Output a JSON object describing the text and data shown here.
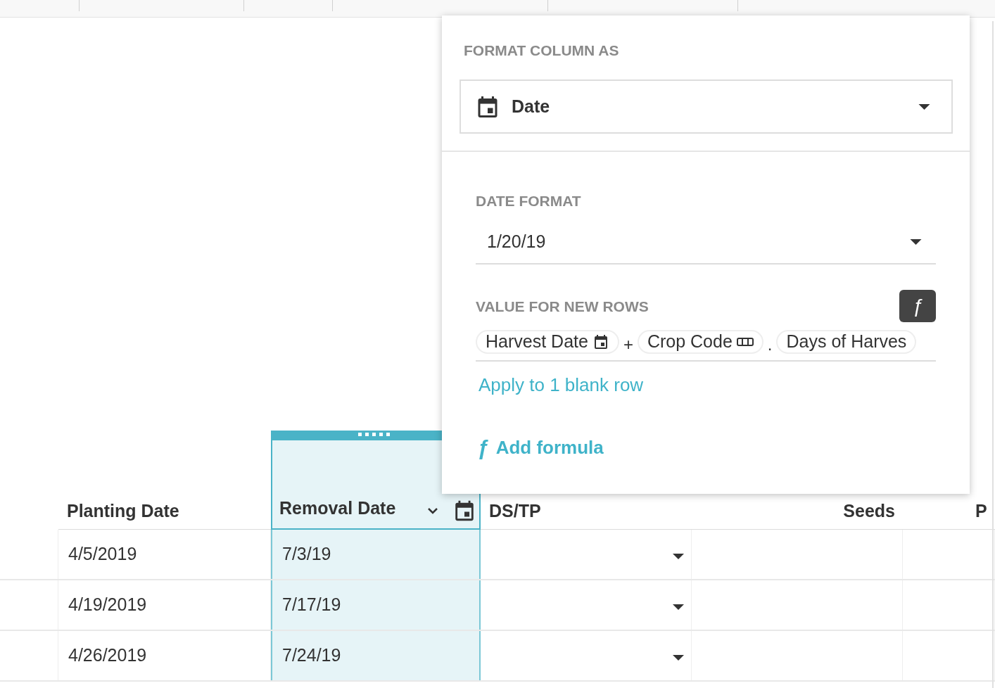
{
  "table": {
    "columns": [
      {
        "label": "Planting Date",
        "selected": false,
        "kind": "text"
      },
      {
        "label": "Removal Date",
        "selected": true,
        "kind": "date"
      },
      {
        "label": "DS/TP",
        "selected": false,
        "kind": "choice"
      },
      {
        "label": "Seeds",
        "selected": false,
        "kind": "number"
      },
      {
        "label": "P",
        "selected": false,
        "kind": "text"
      }
    ],
    "rows": [
      {
        "cells": [
          "4/5/2019",
          "7/3/19",
          "",
          "",
          ""
        ]
      },
      {
        "cells": [
          "4/19/2019",
          "7/17/19",
          "",
          "",
          ""
        ]
      },
      {
        "cells": [
          "4/26/2019",
          "7/24/19",
          "",
          "",
          ""
        ]
      }
    ]
  },
  "popover": {
    "heading": "FORMAT COLUMN AS",
    "format_select": {
      "value": "Date"
    },
    "date_format": {
      "label": "DATE FORMAT",
      "value": "1/20/19"
    },
    "new_rows": {
      "label": "VALUE FOR NEW ROWS",
      "formula_button": "ƒ",
      "formula": [
        {
          "kind": "date_token",
          "text": "Harvest Date"
        },
        {
          "kind": "operator",
          "text": "+"
        },
        {
          "kind": "code_token",
          "text": "Crop Code"
        },
        {
          "kind": "operator",
          "text": "."
        },
        {
          "kind": "token",
          "text": "Days of Harves"
        }
      ],
      "apply_link": "Apply to 1 blank row"
    },
    "add_formula": {
      "icon": "ƒ",
      "label": "Add formula"
    }
  }
}
